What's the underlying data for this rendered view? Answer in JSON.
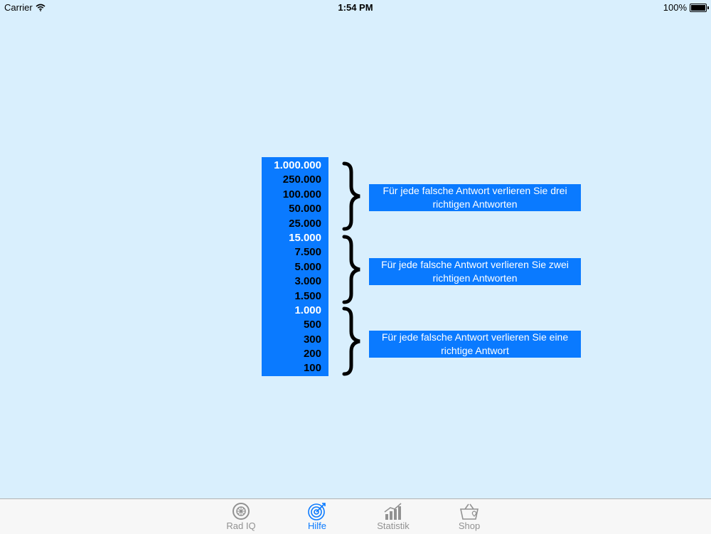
{
  "status_bar": {
    "carrier": "Carrier",
    "time": "1:54 PM",
    "battery": "100%"
  },
  "scores": [
    {
      "value": "1.000.000",
      "milestone": true
    },
    {
      "value": "250.000",
      "milestone": false
    },
    {
      "value": "100.000",
      "milestone": false
    },
    {
      "value": "50.000",
      "milestone": false
    },
    {
      "value": "25.000",
      "milestone": false
    },
    {
      "value": "15.000",
      "milestone": true
    },
    {
      "value": "7.500",
      "milestone": false
    },
    {
      "value": "5.000",
      "milestone": false
    },
    {
      "value": "3.000",
      "milestone": false
    },
    {
      "value": "1.500",
      "milestone": false
    },
    {
      "value": "1.000",
      "milestone": true
    },
    {
      "value": "500",
      "milestone": false
    },
    {
      "value": "300",
      "milestone": false
    },
    {
      "value": "200",
      "milestone": false
    },
    {
      "value": "100",
      "milestone": false
    }
  ],
  "rules": {
    "top": "Für jede falsche Antwort verlieren Sie drei richtigen Antworten",
    "middle": "Für jede falsche Antwort verlieren Sie zwei richtigen Antworten",
    "bottom": "Für jede falsche Antwort verlieren Sie eine richtige Antwort"
  },
  "tabs": {
    "rad_iq": "Rad IQ",
    "hilfe": "Hilfe",
    "statistik": "Statistik",
    "shop": "Shop"
  },
  "colors": {
    "background": "#d9effd",
    "accent": "#0a7aff",
    "inactive_tab": "#929292"
  }
}
